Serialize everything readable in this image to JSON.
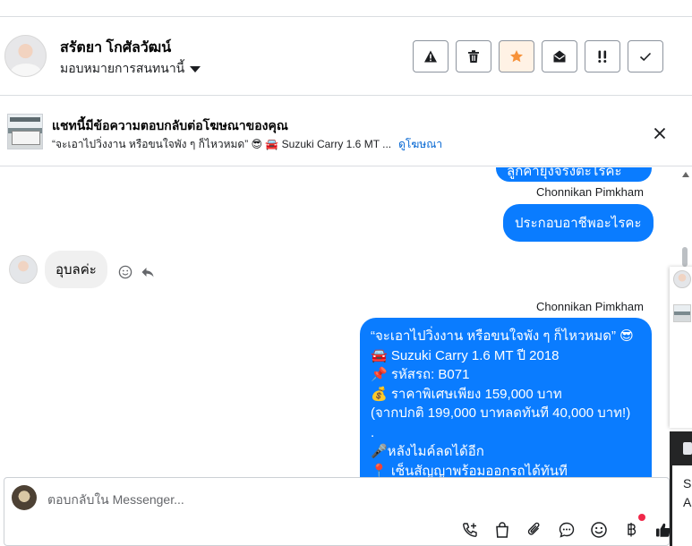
{
  "header": {
    "contact_name": "สรัตยา โกศัลวัฒน์",
    "assign_label": "มอบหมายการสนทนานี้",
    "actions": [
      {
        "name": "report-button",
        "icon": "warning-icon"
      },
      {
        "name": "delete-button",
        "icon": "trash-icon"
      },
      {
        "name": "star-button",
        "icon": "star-icon",
        "color": "#f7923a"
      },
      {
        "name": "mark-unread-button",
        "icon": "envelope-open-icon"
      },
      {
        "name": "follow-up-button",
        "icon": "exclamation-icon"
      },
      {
        "name": "done-button",
        "icon": "check-icon"
      }
    ]
  },
  "ad_banner": {
    "title": "แชทนี้มีข้อความตอบกลับต่อโฆษณาของคุณ",
    "snippet": "“จะเอาไปวิ่งงาน หรือขนใจพัง ๆ ก็ไหวหมด” 😎 🚘 Suzuki Carry 1.6 MT ...",
    "link": "ดูโฆษณา"
  },
  "messages": {
    "partial_top": "ลูกค้ายุ่งจรงตะไรคะ",
    "sender_1": "Chonnikan Pimkham",
    "out_1": "ประกอบอาชีพอะไรคะ",
    "in_1": "อุบลค่ะ",
    "sender_2": "Chonnikan Pimkham",
    "out_2": "“จะเอาไปวิ่งงาน หรือขนใจพัง ๆ ก็ไหวหมด” 😎\n🚘 Suzuki Carry 1.6 MT ปี 2018\n📌 รหัสรถ: B071\n💰 ราคาพิเศษเพียง 159,000 บาท\n(จากปกติ 199,000 บาทลดทันที 40,000 บาท!)\n.\n🎤หลังไมค์ลดได้อีก\n📍 เซ็นสัญญาพร้อมออกรถได้ทันที"
  },
  "side_panel": {
    "text_1": "Se",
    "text_2": "A"
  },
  "composer": {
    "placeholder": "ตอบกลับใน Messenger...",
    "tools": [
      "call-icon",
      "bag-icon",
      "attach-icon",
      "chat-bubble-icon",
      "emoji-icon",
      "baht-icon",
      "thumbs-up-icon"
    ]
  },
  "colors": {
    "outgoing_bubble": "#0a7cff",
    "incoming_bubble": "#f0f0f0",
    "link": "#0064d1",
    "notification_dot": "#f02849"
  }
}
